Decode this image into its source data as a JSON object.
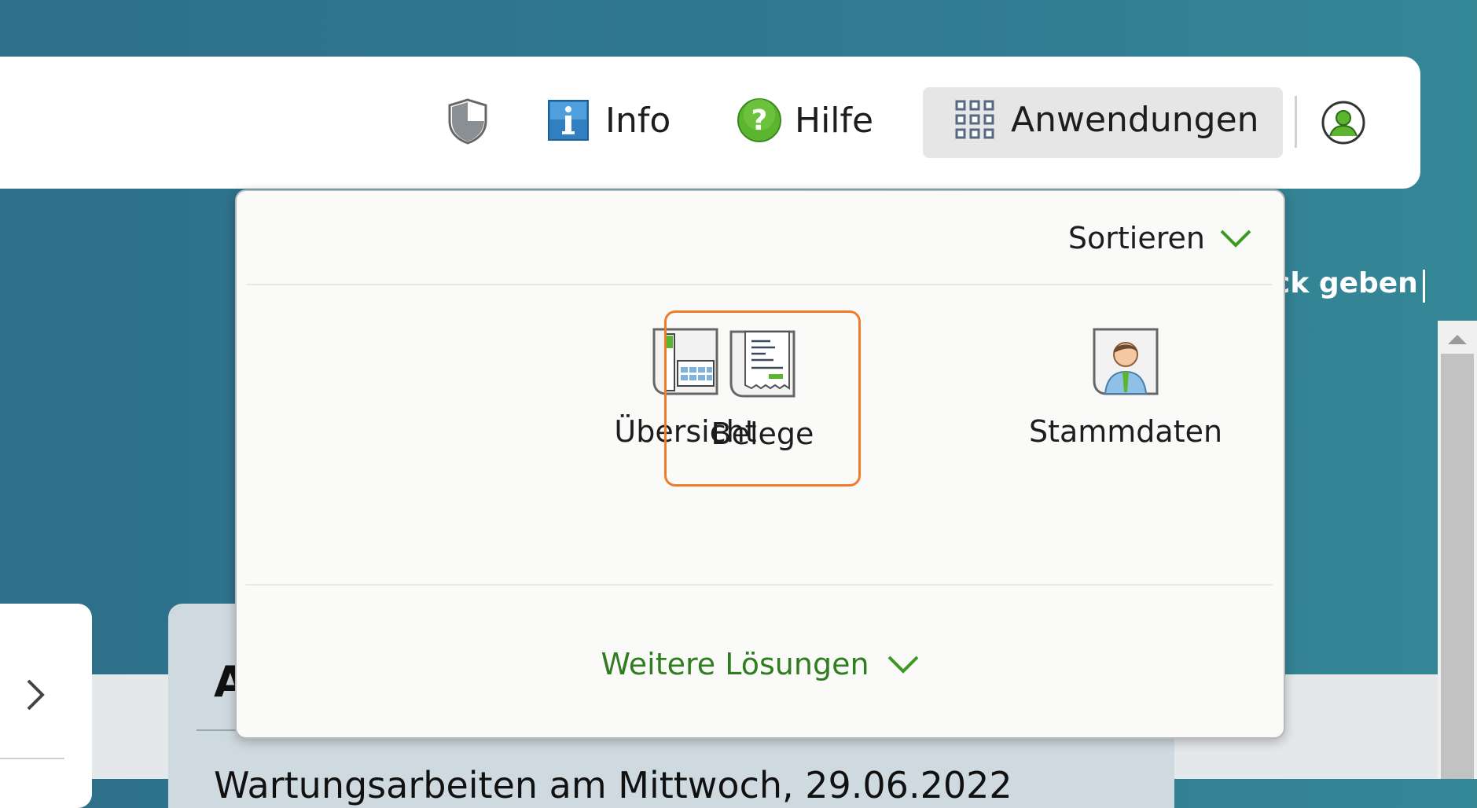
{
  "header": {
    "info_label": "Info",
    "help_label": "Hilfe",
    "apps_label": "Anwendungen"
  },
  "background": {
    "feedback_text": "ck geben",
    "card_heading": "A",
    "card_subtext": "Wartungsarbeiten am Mittwoch, 29.06.2022"
  },
  "dropdown": {
    "sort_label": "Sortieren",
    "tiles": [
      {
        "label": "Übersicht",
        "icon": "overview-icon"
      },
      {
        "label": "Belege",
        "icon": "receipt-icon",
        "selected": true
      },
      {
        "label": "Stammdaten",
        "icon": "person-icon"
      }
    ],
    "more_label": "Weitere Lösungen"
  },
  "colors": {
    "accent_green": "#3a9a24",
    "selected_border": "#f07c2a",
    "background_teal": "#307a92"
  }
}
